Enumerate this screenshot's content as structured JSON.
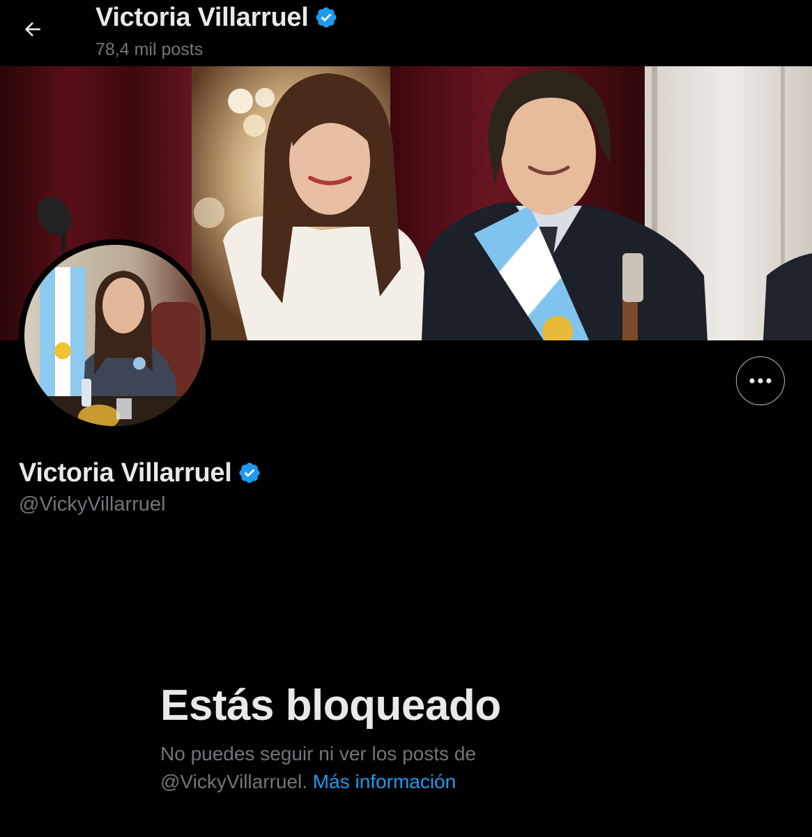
{
  "header": {
    "title": "Victoria Villarruel",
    "posts_count": "78,4 mil posts"
  },
  "profile": {
    "display_name": "Victoria Villarruel",
    "handle": "@VickyVillarruel",
    "verified": true
  },
  "blocked": {
    "title": "Estás bloqueado",
    "message_line1": "No puedes seguir ni ver los posts de",
    "message_handle": "@VickyVillarruel.",
    "learn_more": "Más información"
  },
  "icons": {
    "back": "arrow-left-icon",
    "verified": "verified-badge-icon",
    "more": "more-horizontal-icon"
  },
  "colors": {
    "background": "#000000",
    "primary_text": "#e7e9ea",
    "secondary_text": "#71767b",
    "link": "#1d9bf0",
    "verified_badge": "#1d9bf0"
  }
}
